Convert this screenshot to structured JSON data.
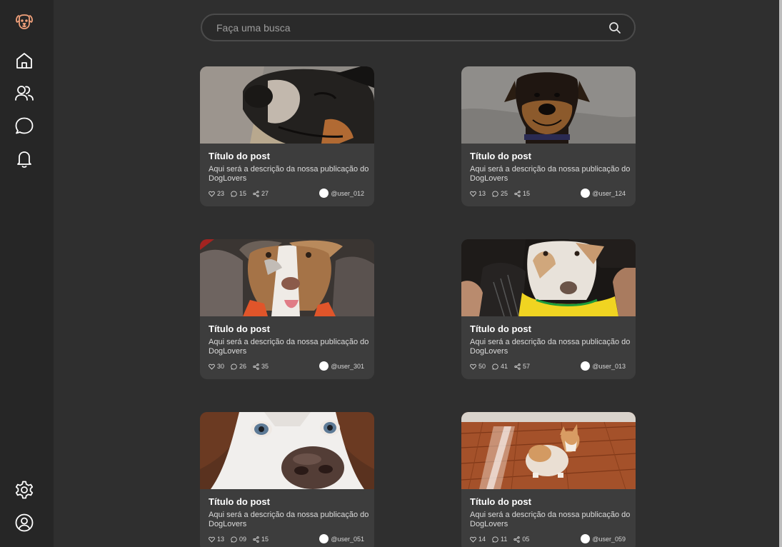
{
  "sidebar": {
    "logo": {
      "icon": "dog-logo-icon",
      "color": "#f0a07a"
    },
    "nav": [
      {
        "icon": "home-icon"
      },
      {
        "icon": "users-icon"
      },
      {
        "icon": "chat-icon"
      },
      {
        "icon": "bell-icon"
      }
    ],
    "bottom": [
      {
        "icon": "gear-icon"
      },
      {
        "icon": "user-circle-icon"
      }
    ]
  },
  "search": {
    "placeholder": "Faça uma busca",
    "value": "",
    "icon": "search-icon"
  },
  "posts": [
    {
      "title": "Título do post",
      "description": "Aqui será a descrição da nossa publicação do DogLovers",
      "likes": "23",
      "comments": "15",
      "shares": "27",
      "user": "@user_012",
      "image": "small dog with eyes half-closed"
    },
    {
      "title": "Título do post",
      "description": "Aqui será a descrição da nossa publicação do DogLovers",
      "likes": "13",
      "comments": "25",
      "shares": "15",
      "user": "@user_124",
      "image": "smiling black and tan dog"
    },
    {
      "title": "Título do post",
      "description": "Aqui será a descrição da nossa publicação do DogLovers",
      "likes": "30",
      "comments": "26",
      "shares": "35",
      "user": "@user_301",
      "image": "australian shepherd puppy"
    },
    {
      "title": "Título do post",
      "description": "Aqui será a descrição da nossa publicação do DogLovers",
      "likes": "50",
      "comments": "41",
      "shares": "57",
      "user": "@user_013",
      "image": "dog in yellow shirt"
    },
    {
      "title": "Título do post",
      "description": "Aqui será a descrição da nossa publicação do DogLovers",
      "likes": "13",
      "comments": "09",
      "shares": "15",
      "user": "@user_051",
      "image": "husky close-up nose"
    },
    {
      "title": "Título do post",
      "description": "Aqui será a descrição da nossa publicação do DogLovers",
      "likes": "14",
      "comments": "11",
      "shares": "05",
      "user": "@user_059",
      "image": "corgi on wooden floor"
    }
  ]
}
